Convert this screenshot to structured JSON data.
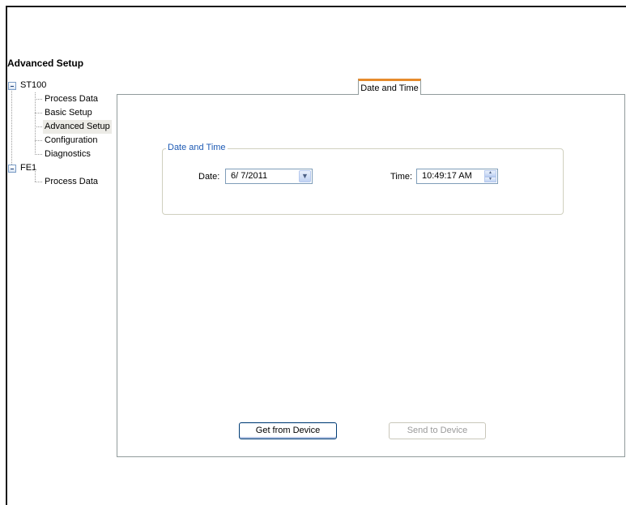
{
  "page": {
    "title": "Advanced Setup"
  },
  "tree": {
    "roots": [
      {
        "label": "ST100",
        "children": [
          "Process Data",
          "Basic Setup",
          "Advanced Setup",
          "Configuration",
          "Diagnostics"
        ],
        "selected": "Advanced Setup"
      },
      {
        "label": "FE1",
        "children": [
          "Process Data"
        ]
      }
    ]
  },
  "tabs": [
    {
      "label": "Date and Time",
      "active": true
    }
  ],
  "group": {
    "title": "Date and Time",
    "date_label": "Date:",
    "date_value": "6/ 7/2011",
    "time_label": "Time:",
    "time_value": "10:49:17 AM"
  },
  "buttons": {
    "get_label": "Get from Device",
    "send_label": "Send to Device"
  },
  "icons": {
    "collapse": "minus-box-icon",
    "dropdown": "chevron-down-icon",
    "spinner": "up-down-arrows-icon"
  },
  "colors": {
    "tab_accent": "#e68b2c",
    "group_title": "#1d5ab4",
    "selected_bg": "#ecebe6"
  }
}
